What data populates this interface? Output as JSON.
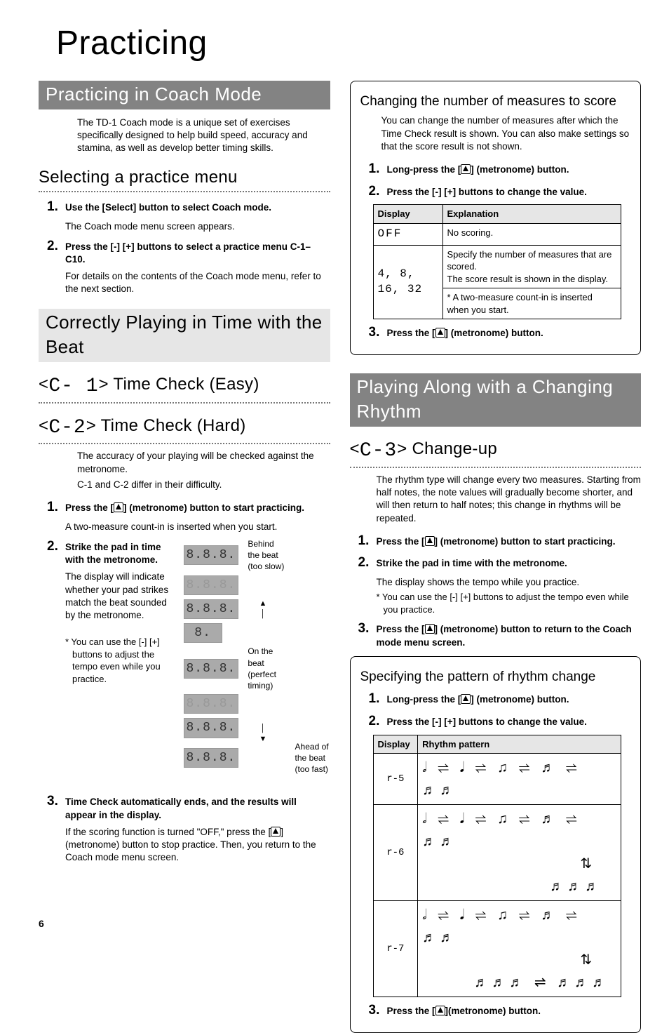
{
  "page": {
    "title": "Practicing",
    "number": "6"
  },
  "left": {
    "gray1": "Practicing in Coach Mode",
    "intro": "The TD-1 Coach mode is a unique set of exercises specifically designed to help build speed, accuracy and stamina, as well as develop better timing skills.",
    "selecting_h": "Selecting a practice menu",
    "step1a": "Use the [Select] button to select Coach mode.",
    "step1a_sub": "The Coach mode menu screen appears.",
    "step2a": "Press the [-] [+] buttons to select a practice menu C-1–C10.",
    "step2a_sub": "For details on the contents of the Coach mode menu, refer to the next section.",
    "band": "Correctly Playing in Time with the Beat",
    "tc_easy_code": "C- 1",
    "tc_easy_label": " Time Check (Easy)",
    "tc_hard_code": "C-2",
    "tc_hard_label": " Time Check (Hard)",
    "tc_body1": "The accuracy of your playing will be checked against the metronome.",
    "tc_body2": "C-1 and C-2 differ in their difficulty.",
    "tc_step1": "Press the [",
    "tc_step1b": "] (metronome) button to start practicing.",
    "tc_step1_sub": "A two-measure count-in is inserted when you start.",
    "tc_step2": "Strike the pad in time with the metronome.",
    "tc_step2_sub": "The display will indicate whether your pad strikes match the beat sounded by the metronome.",
    "tc_step2_note": "* You can use the [-] [+] buttons to adjust the tempo even while you practice.",
    "seg_behind": "Behind the beat (too slow)",
    "seg_on": "On the beat (perfect timing)",
    "seg_ahead": "Ahead of the beat (too fast)",
    "tc_step3": "Time Check automatically ends, and the results will appear in the display.",
    "tc_step3_sub": "If the scoring function is turned \"OFF,\" press the [",
    "tc_step3_sub2": "] (metronome) button to stop practice. Then, you return to the Coach mode menu screen."
  },
  "right": {
    "box1_h": "Changing the number of measures to score",
    "box1_body": "You can change the number of measures after which the Time Check result is shown. You can also make settings so that the score result is not shown.",
    "box1_s1a": "Long-press the [",
    "box1_s1b": "] (metronome) button.",
    "box1_s2": "Press the [-] [+] buttons to change the value.",
    "tbl1_h1": "Display",
    "tbl1_h2": "Explanation",
    "tbl1_r1a": "OFF",
    "tbl1_r1b": "No scoring.",
    "tbl1_r2a": "4, 8, 16, 32",
    "tbl1_r2b1": "Specify the number of measures that are scored.",
    "tbl1_r2b2": "The score result is shown in the display.",
    "tbl1_r2b3": "* A two-measure count-in is inserted when you start.",
    "box1_s3a": "Press the [",
    "box1_s3b": "] (metronome) button.",
    "gray2": "Playing Along with a Changing Rhythm",
    "cu_code": "C-3",
    "cu_label": " Change-up",
    "cu_body": "The rhythm type will change every two measures. Starting from half notes, the note values will gradually become shorter, and will then return to half notes; this change in rhythms will be repeated.",
    "cu_s1a": "Press the [",
    "cu_s1b": "] (metronome) button to start practicing.",
    "cu_s2": "Strike the pad in time with the metronome.",
    "cu_s2_sub": "The display shows the tempo while you practice.",
    "cu_s2_note": "* You can use the [-] [+] buttons to adjust the tempo even while you practice.",
    "cu_s3a": "Press the [",
    "cu_s3b": "] (metronome) button to return to the Coach mode menu screen.",
    "box2_h": "Specifying the pattern of rhythm change",
    "box2_s1a": "Long-press the [",
    "box2_s1b": "] (metronome) button.",
    "box2_s2": "Press the [-] [+] buttons to change the value.",
    "tbl2_h1": "Display",
    "tbl2_h2": "Rhythm pattern",
    "tbl2_r1": "r-5",
    "tbl2_r2": "r-6",
    "tbl2_r3": "r-7",
    "box2_s3a": "Press the [",
    "box2_s3b": "](metronome) button.",
    "rh1": "𝅗𝅥 ⇌ 𝅘𝅥 ⇌ ♫ ⇌ ♬ ⇌ ♬♬",
    "rh2a": "𝅗𝅥 ⇌ 𝅘𝅥 ⇌ ♫ ⇌ ♬ ⇌ ♬♬",
    "rh2b": "⇅",
    "rh2c": "♬♬♬",
    "rh3a": "𝅗𝅥 ⇌ 𝅘𝅥 ⇌ ♫ ⇌ ♬ ⇌ ♬♬",
    "rh3b": "⇅",
    "rh3c": "♬♬♬ ⇌ ♬♬♬"
  }
}
